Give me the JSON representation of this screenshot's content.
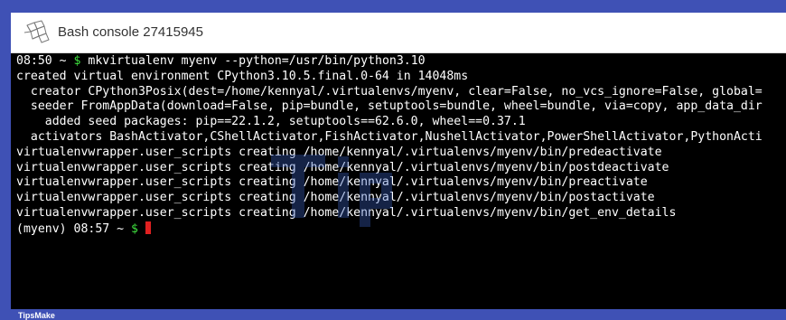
{
  "window": {
    "title": "Bash console 27415945",
    "logo_icon": "python-anywhere-logo-icon"
  },
  "terminal": {
    "background": "#000000",
    "foreground": "#ffffff",
    "prompt_color": "#3ee03e",
    "cursor_color": "#e02020",
    "lines": [
      {
        "pre": "08:50 ~ ",
        "dollar": "$",
        "post": " mkvirtualenv myenv --python=/usr/bin/python3.10"
      },
      {
        "pre": "created virtual environment CPython3.10.5.final.0-64 in 14048ms",
        "dollar": "",
        "post": ""
      },
      {
        "pre": "  creator CPython3Posix(dest=/home/kennyal/.virtualenvs/myenv, clear=False, no_vcs_ignore=False, global=",
        "dollar": "",
        "post": ""
      },
      {
        "pre": "  seeder FromAppData(download=False, pip=bundle, setuptools=bundle, wheel=bundle, via=copy, app_data_dir",
        "dollar": "",
        "post": ""
      },
      {
        "pre": "    added seed packages: pip==22.1.2, setuptools==62.6.0, wheel==0.37.1",
        "dollar": "",
        "post": ""
      },
      {
        "pre": "  activators BashActivator,CShellActivator,FishActivator,NushellActivator,PowerShellActivator,PythonActi",
        "dollar": "",
        "post": ""
      },
      {
        "pre": "virtualenvwrapper.user_scripts creating /home/kennyal/.virtualenvs/myenv/bin/predeactivate",
        "dollar": "",
        "post": ""
      },
      {
        "pre": "virtualenvwrapper.user_scripts creating /home/kennyal/.virtualenvs/myenv/bin/postdeactivate",
        "dollar": "",
        "post": ""
      },
      {
        "pre": "virtualenvwrapper.user_scripts creating /home/kennyal/.virtualenvs/myenv/bin/preactivate",
        "dollar": "",
        "post": ""
      },
      {
        "pre": "virtualenvwrapper.user_scripts creating /home/kennyal/.virtualenvs/myenv/bin/postactivate",
        "dollar": "",
        "post": ""
      },
      {
        "pre": "virtualenvwrapper.user_scripts creating /home/kennyal/.virtualenvs/myenv/bin/get_env_details",
        "dollar": "",
        "post": ""
      },
      {
        "pre": "(myenv) 08:57 ~ ",
        "dollar": "$",
        "post": " ",
        "cursor": true
      }
    ]
  },
  "footer": {
    "brand": "TipsMake",
    "background": "#3f51b5"
  },
  "watermark": {
    "text": "TipsMake"
  }
}
